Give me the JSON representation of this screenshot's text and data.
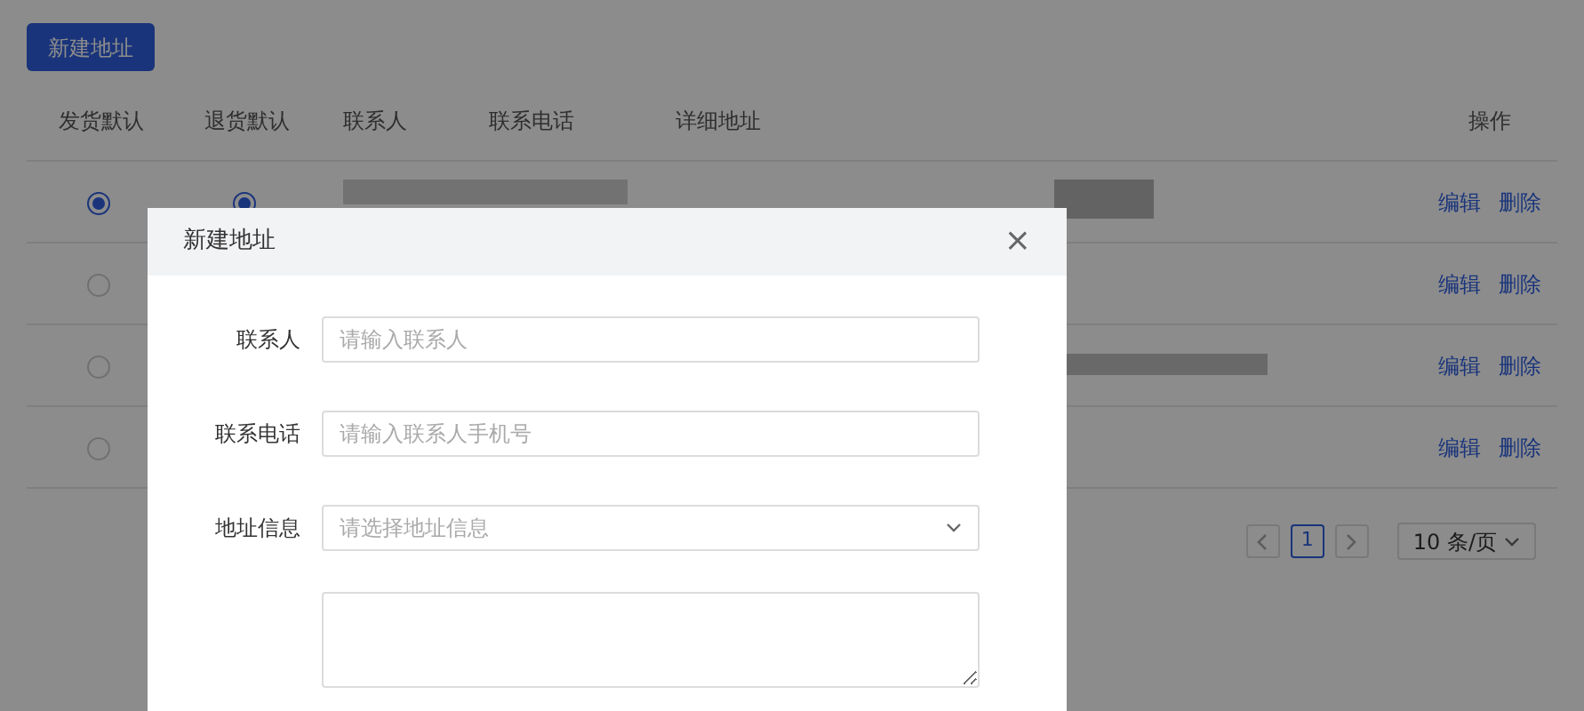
{
  "new_button": "新建地址",
  "table": {
    "columns": [
      "发货默认",
      "退货默认",
      "联系人",
      "联系电话",
      "详细地址",
      "操作"
    ],
    "rows": [
      {
        "ship_default": {
          "selected": true
        },
        "return_default": {
          "selected": true
        },
        "actions": [
          "编辑",
          "删除"
        ]
      },
      {
        "ship_default": {
          "selected": false
        },
        "actions": [
          "编辑",
          "删除"
        ]
      },
      {
        "ship_default": {
          "selected": false
        },
        "actions": [
          "编辑",
          "删除"
        ]
      },
      {
        "ship_default": {
          "selected": false
        },
        "actions": [
          "编辑",
          "删除"
        ]
      }
    ]
  },
  "pagination": {
    "pages": [
      {
        "label": "1",
        "selected": true
      }
    ],
    "page_size": "10 条/页"
  },
  "dialog": {
    "title": "新建地址",
    "close": "×",
    "fields": [
      {
        "kind": "input",
        "label": "联系人",
        "placeholder": "请输入联系人"
      },
      {
        "kind": "input",
        "label": "联系电话",
        "placeholder": "请输入联系人手机号"
      },
      {
        "kind": "select",
        "label": "地址信息",
        "placeholder": "请选择地址信息"
      },
      {
        "kind": "textarea"
      }
    ]
  }
}
